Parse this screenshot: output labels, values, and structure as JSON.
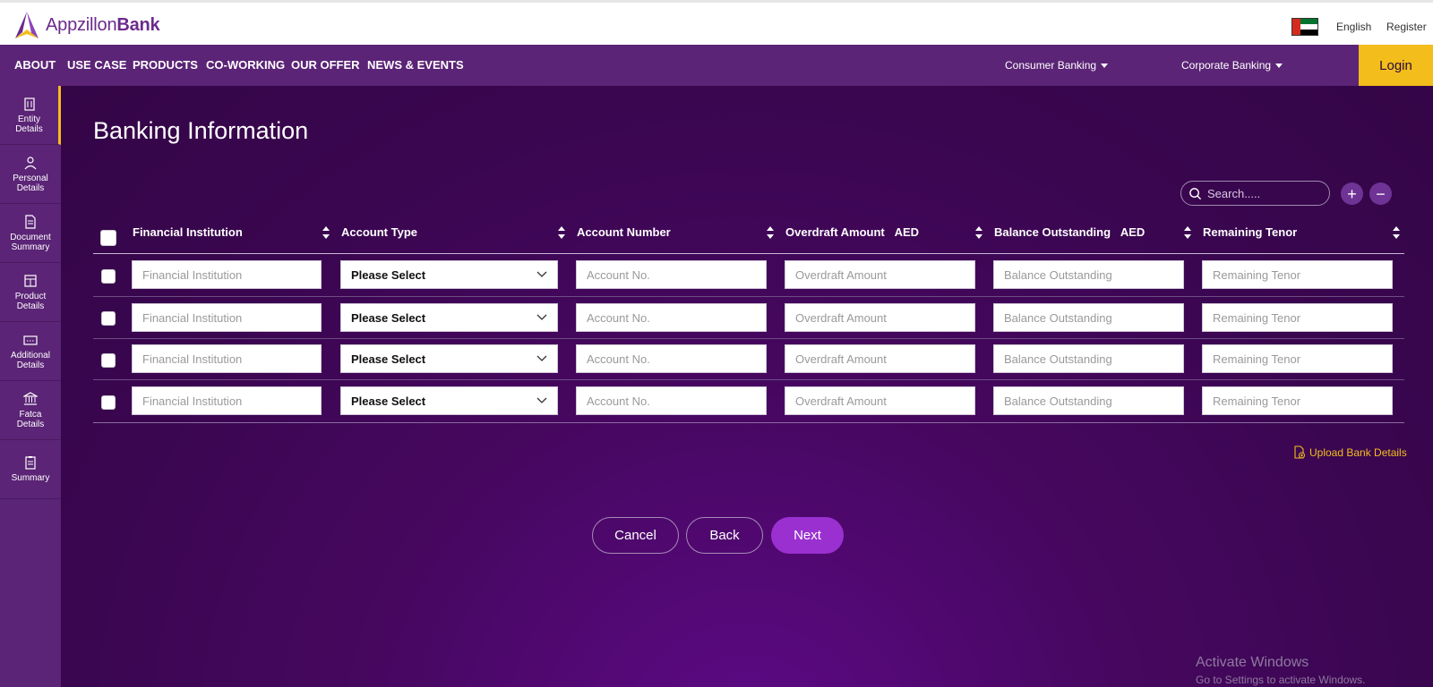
{
  "header": {
    "logo_part1": "Appzillon",
    "logo_part2": "Bank",
    "language": "English",
    "register": "Register"
  },
  "nav": {
    "items": [
      "ABOUT",
      "USE CASE",
      "PRODUCTS",
      "CO-WORKING",
      "OUR OFFER",
      "NEWS & EVENTS"
    ],
    "consumer_banking": "Consumer Banking",
    "corporate_banking": "Corporate Banking",
    "login": "Login"
  },
  "sidebar": {
    "items": [
      {
        "line1": "Entity",
        "line2": "Details",
        "icon": "building-icon"
      },
      {
        "line1": "Personal",
        "line2": "Details",
        "icon": "person-icon"
      },
      {
        "line1": "Document",
        "line2": "Summary",
        "icon": "document-icon"
      },
      {
        "line1": "Product",
        "line2": "Details",
        "icon": "product-icon"
      },
      {
        "line1": "Additional",
        "line2": "Details",
        "icon": "card-icon"
      },
      {
        "line1": "Fatca",
        "line2": "Details",
        "icon": "bank-icon"
      },
      {
        "line1": "Summary",
        "line2": "",
        "icon": "clipboard-icon"
      }
    ]
  },
  "page": {
    "title": "Banking Information",
    "search_placeholder": "Search.....",
    "add_symbol": "+",
    "remove_symbol": "−"
  },
  "table": {
    "columns": [
      {
        "label": "Financial Institution",
        "unit": ""
      },
      {
        "label": "Account Type",
        "unit": ""
      },
      {
        "label": "Account Number",
        "unit": ""
      },
      {
        "label": "Overdraft Amount",
        "unit": "AED"
      },
      {
        "label": "Balance Outstanding",
        "unit": "AED"
      },
      {
        "label": "Remaining Tenor",
        "unit": ""
      }
    ],
    "placeholders": {
      "financial_institution": "Financial Institution",
      "account_type": "Please Select",
      "account_number": "Account No.",
      "overdraft_amount": "Overdraft Amount",
      "balance_outstanding": "Balance Outstanding",
      "remaining_tenor": "Remaining Tenor"
    },
    "row_count": 4
  },
  "actions": {
    "upload": "Upload Bank Details",
    "cancel": "Cancel",
    "back": "Back",
    "next": "Next"
  },
  "watermark": {
    "line1": "Activate Windows",
    "line2": "Go to Settings to activate Windows."
  },
  "colors": {
    "primary_purple": "#5b2476",
    "accent_yellow": "#f3bd1c",
    "next_button": "#9b30d1"
  }
}
